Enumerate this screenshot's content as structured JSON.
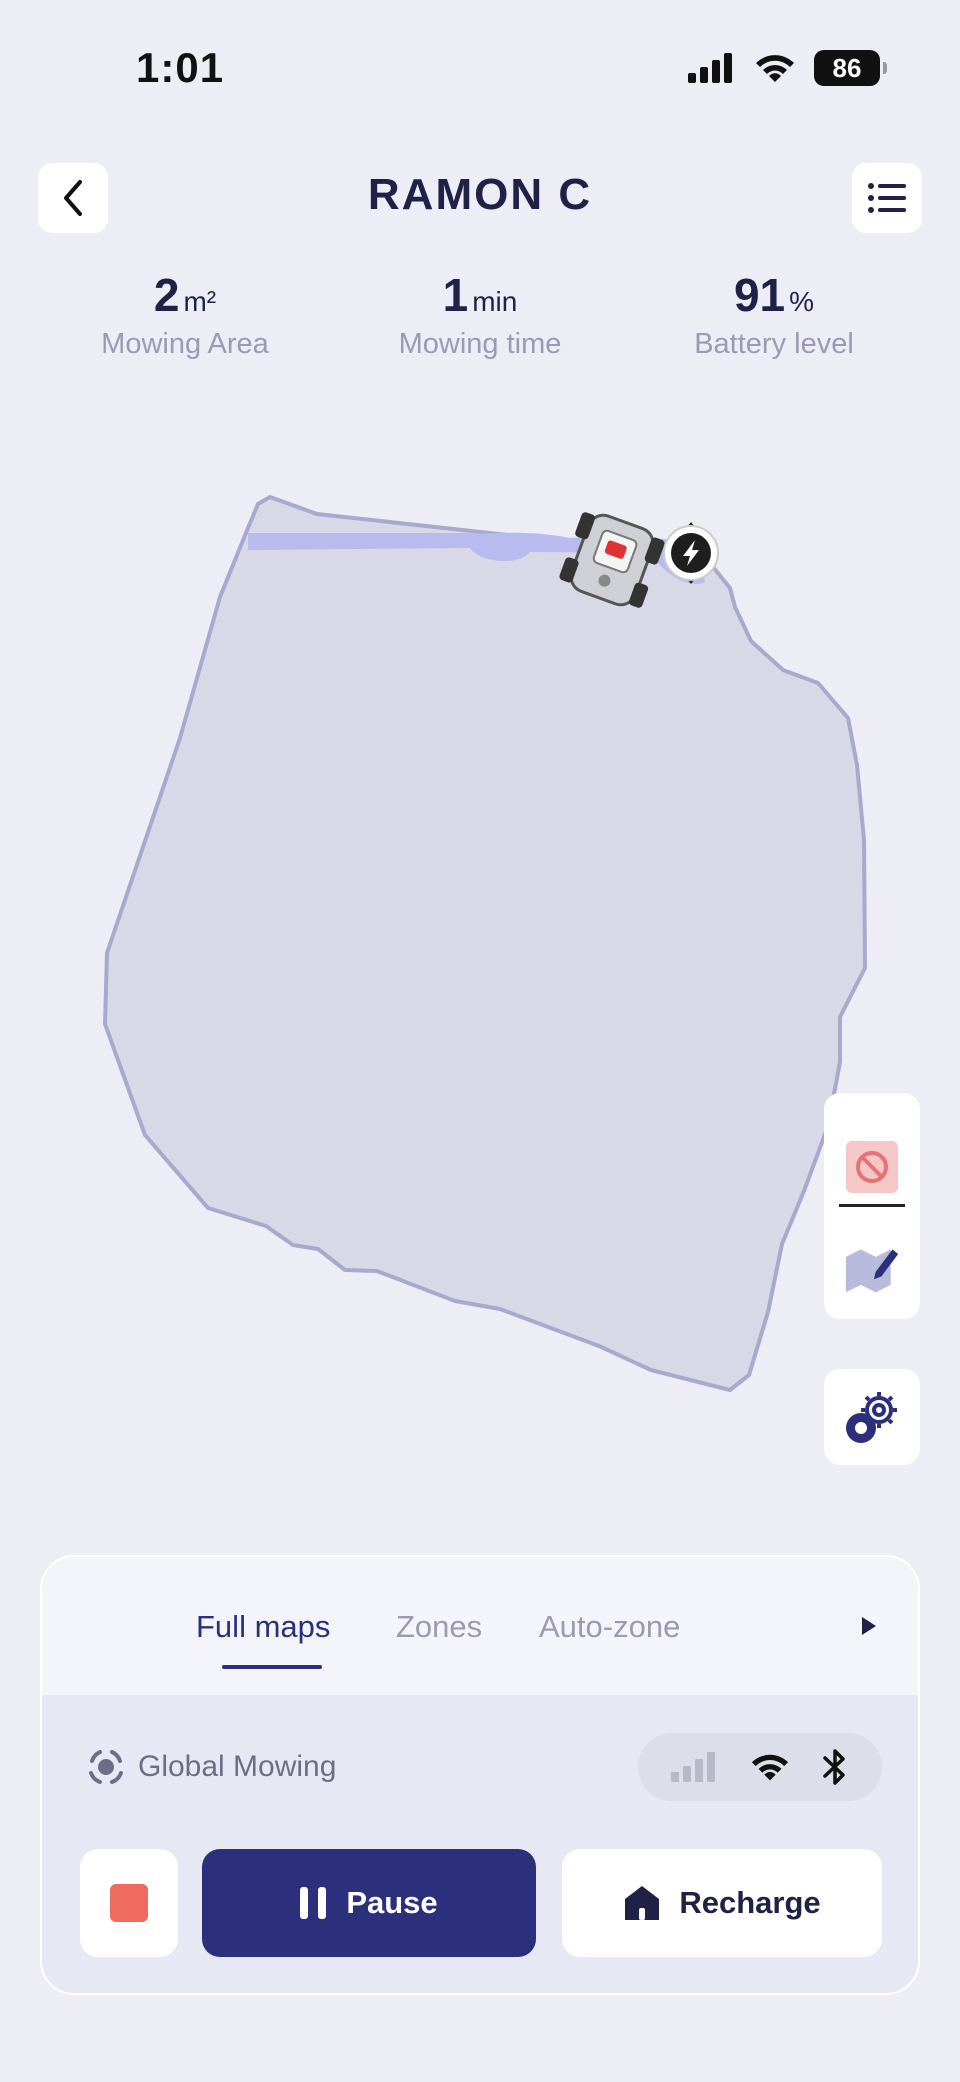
{
  "status_bar": {
    "time": "1:01",
    "battery": "86"
  },
  "header": {
    "title": "RAMON C"
  },
  "stats": [
    {
      "value": "2",
      "unit": "m²",
      "label": "Mowing Area"
    },
    {
      "value": "1",
      "unit": "min",
      "label": "Mowing time"
    },
    {
      "value": "91",
      "unit": "%",
      "label": "Battery level"
    }
  ],
  "tabs": {
    "items": [
      "Full maps",
      "Zones",
      "Auto-zone"
    ],
    "active": "Full maps"
  },
  "mode": {
    "label": "Global Mowing"
  },
  "actions": {
    "pause_label": "Pause",
    "recharge_label": "Recharge"
  },
  "colors": {
    "primary": "#2c2f7c",
    "stop": "#ef6a5f",
    "map_fill": "#d8d9e6",
    "map_stroke": "#a9a8cf",
    "mowed_path": "#b9bbef"
  },
  "icons": [
    "back-icon",
    "list-icon",
    "no-go-zone-icon",
    "map-edit-icon",
    "settings-gear-icon",
    "global-mowing-icon",
    "cellular-icon",
    "wifi-icon",
    "bluetooth-icon",
    "house-icon",
    "charging-station-icon",
    "robot-mower-icon",
    "chevron-right-icon"
  ]
}
